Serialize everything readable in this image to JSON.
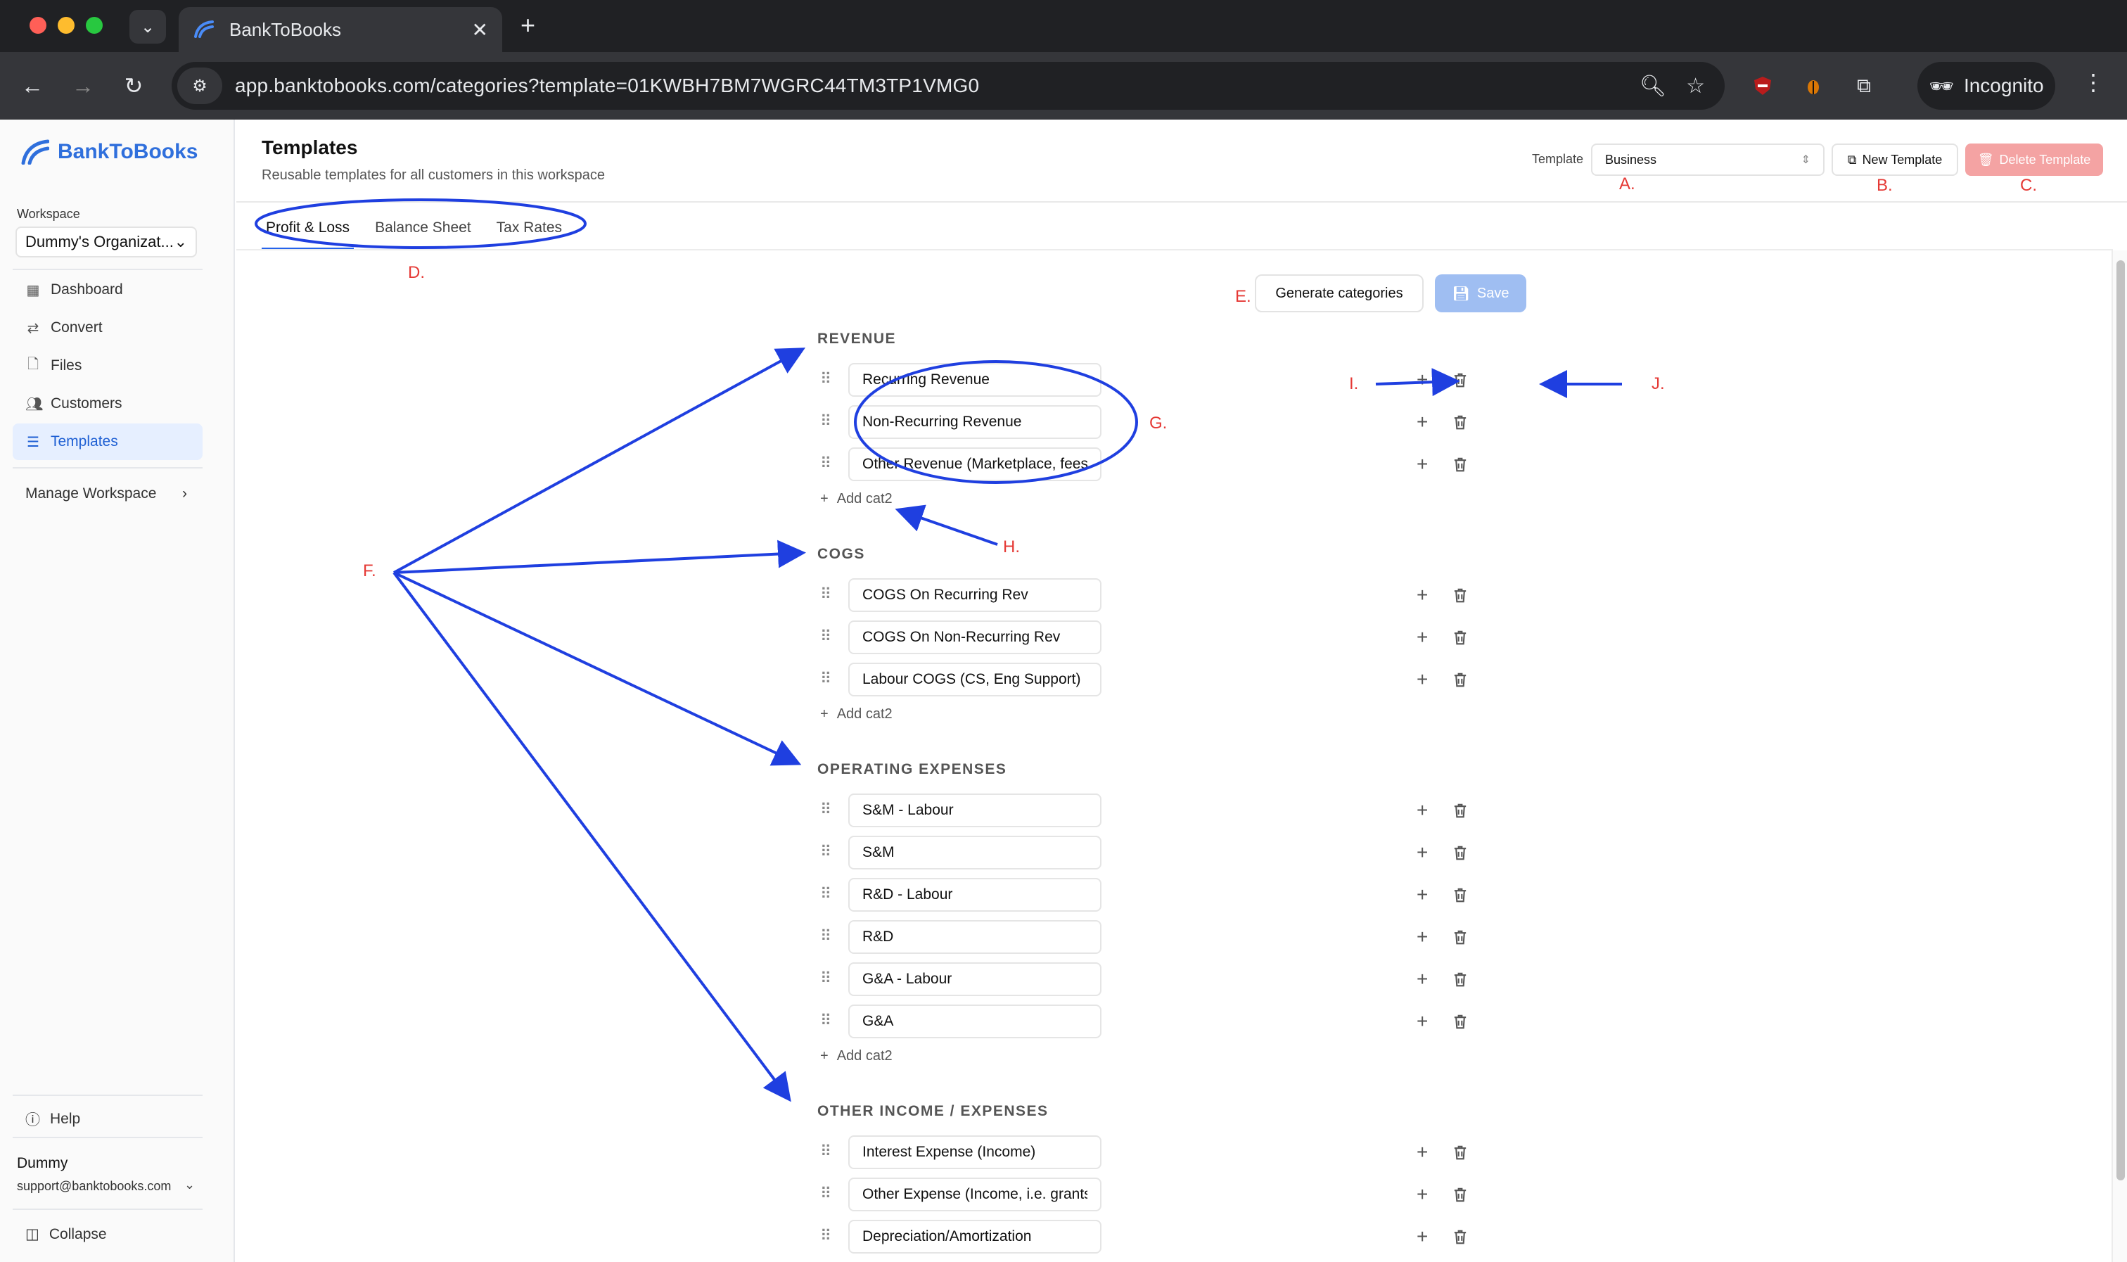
{
  "browser": {
    "tab_title": "BankToBooks",
    "url": "app.banktobooks.com/categories?template=01KWBH7BM7WGRC44TM3TP1VMG0",
    "incognito_label": "Incognito"
  },
  "sidebar": {
    "brand": "BankToBooks",
    "workspace_label": "Workspace",
    "workspace_value": "Dummy's Organizat...",
    "nav": [
      {
        "label": "Dashboard",
        "icon": "dashboard-icon"
      },
      {
        "label": "Convert",
        "icon": "convert-icon"
      },
      {
        "label": "Files",
        "icon": "file-icon"
      },
      {
        "label": "Customers",
        "icon": "users-icon"
      },
      {
        "label": "Templates",
        "icon": "list-icon"
      }
    ],
    "manage_workspace": "Manage Workspace",
    "help": "Help",
    "user_name": "Dummy",
    "user_email": "support@banktobooks.com",
    "collapse": "Collapse"
  },
  "header": {
    "title": "Templates",
    "subtitle": "Reusable templates for all customers in this workspace",
    "template_label": "Template",
    "template_value": "Business",
    "new_template": "New Template",
    "delete_template": "Delete Template"
  },
  "tabs": [
    "Profit & Loss",
    "Balance Sheet",
    "Tax Rates"
  ],
  "actions": {
    "generate": "Generate categories",
    "save": "Save"
  },
  "add_cat_label": "Add cat2",
  "sections": [
    {
      "title": "REVENUE",
      "items": [
        "Recurring Revenue",
        "Non-Recurring Revenue",
        "Other Revenue (Marketplace, fees"
      ]
    },
    {
      "title": "COGS",
      "items": [
        "COGS On Recurring Rev",
        "COGS On Non-Recurring Rev",
        "Labour COGS (CS, Eng Support)"
      ]
    },
    {
      "title": "OPERATING EXPENSES",
      "items": [
        "S&M - Labour",
        "S&M",
        "R&D - Labour",
        "R&D",
        "G&A - Labour",
        "G&A"
      ]
    },
    {
      "title": "OTHER INCOME / EXPENSES",
      "items": [
        "Interest Expense (Income)",
        "Other Expense (Income, i.e. grants",
        "Depreciation/Amortization"
      ]
    }
  ],
  "annotations": {
    "A": "A.",
    "B": "B.",
    "C": "C.",
    "D": "D.",
    "E": "E.",
    "F": "F.",
    "G": "G.",
    "H": "H.",
    "I": "I.",
    "J": "J."
  },
  "colors": {
    "accent": "#2563eb",
    "annotation_text": "#e53935",
    "annotation_stroke": "#1f3fe0"
  }
}
